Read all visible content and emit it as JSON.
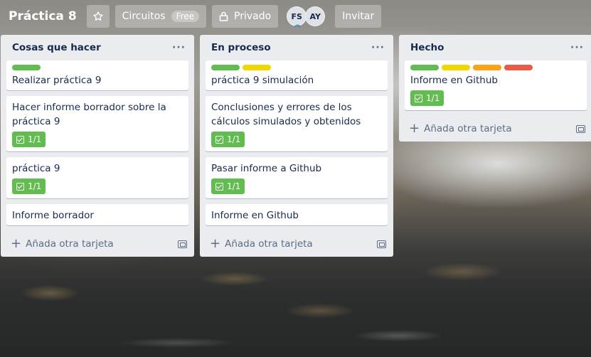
{
  "header": {
    "board_title": "Práctica 8",
    "team_button_label": "Circuitos",
    "team_badge": "Free",
    "visibility_label": "Privado",
    "members": [
      {
        "initials": "FS",
        "admin": true
      },
      {
        "initials": "AY",
        "admin": false
      }
    ],
    "invite_label": "Invitar"
  },
  "colors": {
    "green": "#61bd4f",
    "yellow": "#f2d600",
    "orange": "#ff9f1a",
    "red": "#eb5a46"
  },
  "lists": [
    {
      "title": "Cosas que hacer",
      "menu_icon": "ellipsis-icon",
      "cards": [
        {
          "title": "Realizar práctica 9",
          "labels": [
            "#61bd4f"
          ],
          "checklist": null
        },
        {
          "title": "Hacer informe borrador sobre la práctica 9",
          "labels": [],
          "checklist": "1/1"
        },
        {
          "title": "práctica 9",
          "labels": [],
          "checklist": "1/1"
        },
        {
          "title": "Informe borrador",
          "labels": [],
          "checklist": null
        }
      ],
      "add_card_label": "Añada otra tarjeta"
    },
    {
      "title": "En proceso",
      "menu_icon": "ellipsis-icon",
      "cards": [
        {
          "title": "práctica 9 simulación",
          "labels": [
            "#61bd4f",
            "#f2d600"
          ],
          "checklist": null
        },
        {
          "title": "Conclusiones y errores de los cálculos simulados y obtenidos",
          "labels": [],
          "checklist": "1/1"
        },
        {
          "title": "Pasar informe a Github",
          "labels": [],
          "checklist": "1/1"
        },
        {
          "title": "Informe en Github",
          "labels": [],
          "checklist": null
        }
      ],
      "add_card_label": "Añada otra tarjeta"
    },
    {
      "title": "Hecho",
      "menu_icon": "ellipsis-icon",
      "cards": [
        {
          "title": "Informe en Github",
          "labels": [
            "#61bd4f",
            "#f2d600",
            "#ff9f1a",
            "#eb5a46"
          ],
          "checklist": "1/1"
        }
      ],
      "add_card_label": "Añada otra tarjeta"
    }
  ]
}
